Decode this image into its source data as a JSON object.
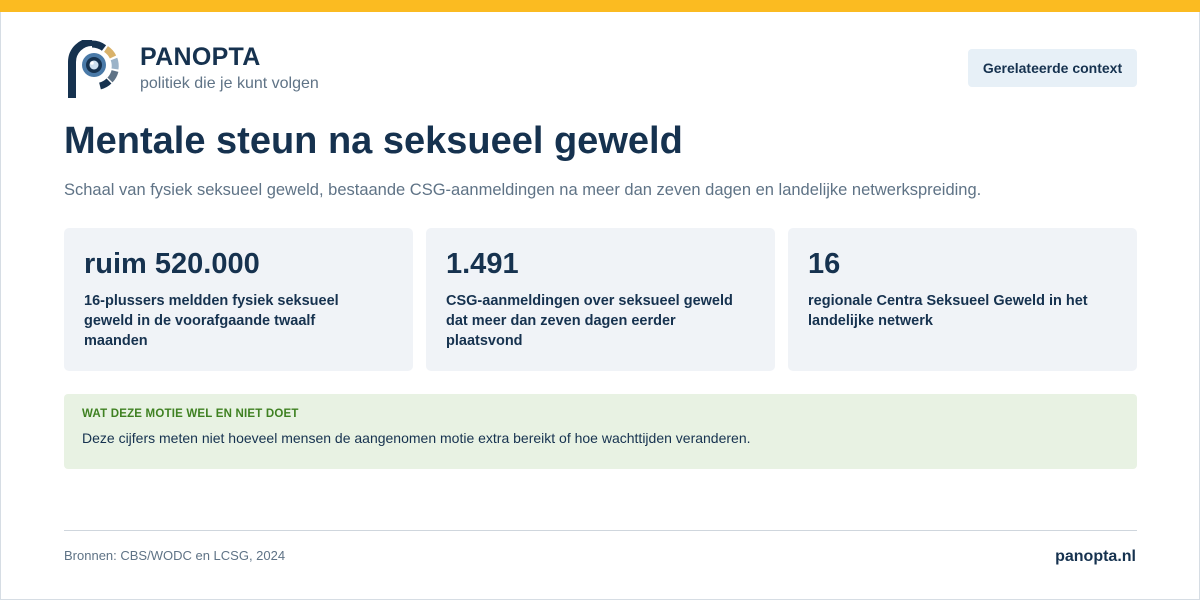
{
  "colors": {
    "accent_bar": "#fbbb21",
    "brand_navy": "#16324f",
    "muted_text": "#5f7386",
    "card_background": "#f0f3f7",
    "button_background": "#e7f0f7",
    "notice_background": "#e8f2e3",
    "notice_heading": "#3f8122"
  },
  "header": {
    "logo_icon": "panopta-eye-logo-icon",
    "brand_name": "PANOPTA",
    "tagline": "politiek die je kunt volgen",
    "context_button_label": "Gerelateerde context"
  },
  "main": {
    "title": "Mentale steun na seksueel geweld",
    "subtitle": "Schaal van fysiek seksueel geweld, bestaande CSG-aanmeldingen na meer dan zeven dagen en landelijke netwerkspreiding.",
    "stats": [
      {
        "value": "ruim 520.000",
        "description": "16-plussers meldden fysiek seksueel geweld in de voorafgaande twaalf maanden"
      },
      {
        "value": "1.491",
        "description": "CSG-aanmeldingen over seksueel geweld dat meer dan zeven dagen eerder plaatsvond"
      },
      {
        "value": "16",
        "description": "regionale Centra Seksueel Geweld in het landelijke netwerk"
      }
    ],
    "notice": {
      "heading": "WAT DEZE MOTIE WEL EN NIET DOET",
      "text": "Deze cijfers meten niet hoeveel mensen de aangenomen motie extra bereikt of hoe wachttijden veranderen."
    }
  },
  "footer": {
    "sources": "Bronnen: CBS/WODC en LCSG, 2024",
    "site": "panopta.nl"
  }
}
